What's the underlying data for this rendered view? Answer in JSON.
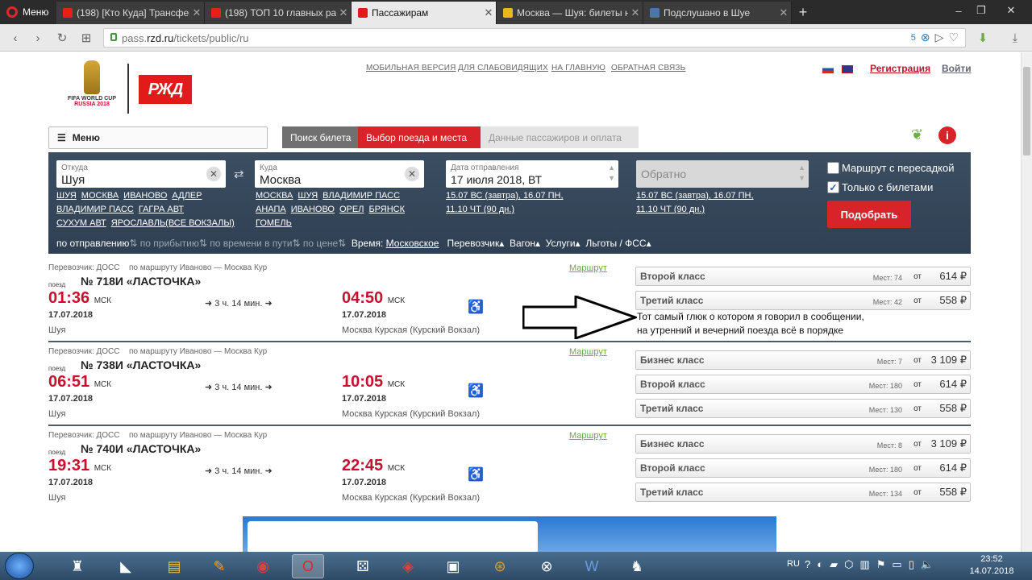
{
  "browser": {
    "menu_label": "Меню",
    "tabs": [
      {
        "label": "(198) [Кто Куда] Трансфер",
        "color": "#e62117"
      },
      {
        "label": "(198) ТОП 10 главных раз",
        "color": "#e62117"
      },
      {
        "label": "Пассажирам",
        "color": "#e21a1a"
      },
      {
        "label": "Москва — Шуя: билеты н",
        "color": "#e8b81c"
      },
      {
        "label": "Подслушано в Шуе",
        "color": "#4a76a8"
      }
    ],
    "new_tab": "+",
    "url_domain": "pass.",
    "url_host": "rzd.ru",
    "url_path": "/tickets/public/ru",
    "badge_count": "5"
  },
  "header": {
    "links": [
      "МОБИЛЬНАЯ ВЕРСИЯ",
      "ДЛЯ СЛАБОВИДЯЩИХ",
      "НА ГЛАВНУЮ",
      "ОБРАТНАЯ СВЯЗЬ"
    ],
    "register": "Регистрация",
    "login": "Войти",
    "wc_line1": "FIFA WORLD CUP",
    "wc_line2": "RUSSIA 2018",
    "rzd_logo": "РЖД"
  },
  "menu": {
    "label": "Меню"
  },
  "steps": [
    "Поиск билета",
    "Выбор поезда и места",
    "Данные пассажиров и оплата"
  ],
  "search": {
    "from_label": "Откуда",
    "from_value": "Шуя",
    "from_quick": [
      "ШУЯ",
      "МОСКВА",
      "ИВАНОВО",
      "АДЛЕР",
      "ВЛАДИМИР ПАСС",
      "ГАГРА АВТ",
      "СУХУМ АВТ",
      "ЯРОСЛАВЛЬ(ВСЕ ВОКЗАЛЫ)"
    ],
    "to_label": "Куда",
    "to_value": "Москва",
    "to_quick": [
      "МОСКВА",
      "ШУЯ",
      "ВЛАДИМИР ПАСС",
      "АНАПА",
      "ИВАНОВО",
      "ОРЕЛ",
      "БРЯНСК",
      "ГОМЕЛЬ"
    ],
    "date_label": "Дата отправления",
    "date_value": "17 июля 2018, ВТ",
    "date_quick1": "15.07 ВС (завтра), 16.07 ПН,",
    "date_quick2": "11.10 ЧТ (90 дн.)",
    "return_placeholder": "Обратно",
    "return_quick1": "15.07 ВС (завтра), 16.07 ПН,",
    "return_quick2": "11.10 ЧТ (90 дн.)",
    "transfer_label": "Маршрут с пересадкой",
    "transfer_checked": false,
    "only_tickets_label": "Только с билетами",
    "only_tickets_checked": true,
    "submit": "Подобрать"
  },
  "sort": {
    "by_departure": "по отправлению",
    "by_arrival": "по прибытию",
    "by_travel": "по времени в пути",
    "by_price": "по цене",
    "time_label": "Время:",
    "time_value": "Московское",
    "carrier": "Перевозчик",
    "car": "Вагон",
    "services": "Услуги",
    "benefits": "Льготы / ФСС"
  },
  "trains": [
    {
      "carrier": "Перевозчик: ДОСС",
      "route": "по маршруту Иваново — Москва Кур",
      "route_link": "Маршрут",
      "type": "поезд",
      "name": "№ 718И «ЛАСТОЧКА»",
      "dep_time": "01:36",
      "dep_tz": "МСК",
      "dep_date": "17.07.2018",
      "dep_station": "Шуя",
      "duration": "3 ч. 14 мин.",
      "arr_time": "04:50",
      "arr_tz": "МСК",
      "arr_date": "17.07.2018",
      "arr_station": "Москва Курская (Курский Вокзал)",
      "classes": [
        {
          "name": "Второй класс",
          "seats": "Мест: 74",
          "from": "от",
          "price": "614 ₽"
        },
        {
          "name": "Третий класс",
          "seats": "Мест: 42",
          "from": "от",
          "price": "558 ₽"
        }
      ]
    },
    {
      "carrier": "Перевозчик: ДОСС",
      "route": "по маршруту Иваново — Москва Кур",
      "route_link": "Маршрут",
      "type": "поезд",
      "name": "№ 738И «ЛАСТОЧКА»",
      "dep_time": "06:51",
      "dep_tz": "МСК",
      "dep_date": "17.07.2018",
      "dep_station": "Шуя",
      "duration": "3 ч. 14 мин.",
      "arr_time": "10:05",
      "arr_tz": "МСК",
      "arr_date": "17.07.2018",
      "arr_station": "Москва Курская (Курский Вокзал)",
      "classes": [
        {
          "name": "Бизнес класс",
          "seats": "Мест: 7",
          "from": "от",
          "price": "3 109 ₽"
        },
        {
          "name": "Второй класс",
          "seats": "Мест: 180",
          "from": "от",
          "price": "614 ₽"
        },
        {
          "name": "Третий класс",
          "seats": "Мест: 130",
          "from": "от",
          "price": "558 ₽"
        }
      ]
    },
    {
      "carrier": "Перевозчик: ДОСС",
      "route": "по маршруту Иваново — Москва Кур",
      "route_link": "Маршрут",
      "type": "поезд",
      "name": "№ 740И «ЛАСТОЧКА»",
      "dep_time": "19:31",
      "dep_tz": "МСК",
      "dep_date": "17.07.2018",
      "dep_station": "Шуя",
      "duration": "3 ч. 14 мин.",
      "arr_time": "22:45",
      "arr_tz": "МСК",
      "arr_date": "17.07.2018",
      "arr_station": "Москва Курская (Курский Вокзал)",
      "classes": [
        {
          "name": "Бизнес класс",
          "seats": "Мест: 8",
          "from": "от",
          "price": "3 109 ₽"
        },
        {
          "name": "Второй класс",
          "seats": "Мест: 180",
          "from": "от",
          "price": "614 ₽"
        },
        {
          "name": "Третий класс",
          "seats": "Мест: 134",
          "from": "от",
          "price": "558 ₽"
        }
      ]
    }
  ],
  "annotation": {
    "line1": "Тот самый глюк о котором я говорил в сообщении,",
    "line2": "на утренний и вечерний поезда всё в порядке"
  },
  "taskbar": {
    "lang": "RU",
    "time": "23:52",
    "date": "14.07.2018"
  },
  "colors": {
    "accent": "#d8232a",
    "panel": "#34475a",
    "link_green": "#6aa84f"
  }
}
